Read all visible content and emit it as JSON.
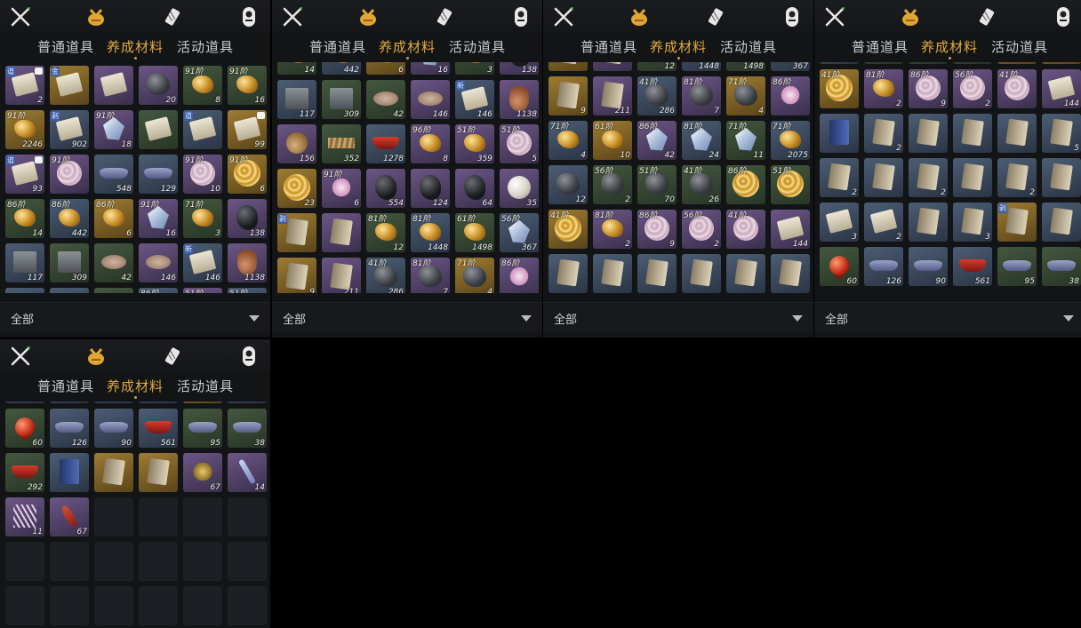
{
  "tabs": [
    "普通道具",
    "养成材料",
    "活动道具"
  ],
  "active_tab": "养成材料",
  "top_icons": [
    "crossed-swords-icon",
    "pouch-icon",
    "scroll-icon",
    "portal-icon"
  ],
  "filter": {
    "label": "全部"
  },
  "colors": {
    "tab_active": "#e1ab3d",
    "tab_inactive": "#c9cbcf",
    "panel_bg": "#121416",
    "page_bg": "#000000"
  },
  "panels": [
    {
      "rows": [
        [
          {
            "q": "p",
            "icon": "scroll",
            "tag": "道",
            "qty": "2",
            "corner": true
          },
          {
            "q": "g",
            "icon": "scroll",
            "tag": "金"
          },
          {
            "q": "p",
            "icon": "scroll"
          },
          {
            "q": "p",
            "icon": "ore",
            "qty": "20"
          },
          {
            "q": "n",
            "icon": "nugget",
            "tier": "91阶",
            "qty": "8"
          },
          {
            "q": "n",
            "icon": "nugget",
            "tier": "91阶",
            "qty": "16"
          }
        ],
        [
          {
            "q": "g",
            "icon": "nugget",
            "tier": "91阶",
            "qty": "2246"
          },
          {
            "q": "b",
            "icon": "scroll",
            "tag": "剥",
            "qty": "902"
          },
          {
            "q": "p",
            "icon": "crystal",
            "tier": "91阶",
            "qty": "18"
          },
          {
            "q": "n",
            "icon": "scroll"
          },
          {
            "q": "b",
            "icon": "scroll",
            "tag": "道"
          },
          {
            "q": "g",
            "icon": "scroll",
            "qty": "99",
            "corner": true
          }
        ],
        [
          {
            "q": "p",
            "icon": "scroll",
            "tag": "道",
            "qty": "93",
            "corner": true
          },
          {
            "q": "p",
            "icon": "shell",
            "tier": "91阶"
          },
          {
            "q": "b",
            "icon": "boat",
            "qty": "548"
          },
          {
            "q": "b",
            "icon": "boat",
            "qty": "129"
          },
          {
            "q": "p",
            "icon": "shell",
            "tier": "91阶",
            "qty": "10"
          },
          {
            "q": "g",
            "icon": "gshell",
            "tier": "91阶",
            "qty": "6"
          }
        ],
        [
          {
            "q": "n",
            "icon": "nugget",
            "tier": "86阶",
            "qty": "14"
          },
          {
            "q": "b",
            "icon": "nugget",
            "tier": "86阶",
            "qty": "442"
          },
          {
            "q": "g",
            "icon": "nugget",
            "tier": "86阶",
            "qty": "6"
          },
          {
            "q": "p",
            "icon": "crystal",
            "tier": "91阶",
            "qty": "16"
          },
          {
            "q": "n",
            "icon": "nugget",
            "tier": "71阶",
            "qty": "3"
          },
          {
            "q": "p",
            "icon": "blackore",
            "qty": "138"
          }
        ],
        [
          {
            "q": "b",
            "icon": "box",
            "qty": "117"
          },
          {
            "q": "n",
            "icon": "box",
            "qty": "309"
          },
          {
            "q": "n",
            "icon": "coin",
            "qty": "42"
          },
          {
            "q": "p",
            "icon": "coin",
            "qty": "146"
          },
          {
            "q": "b",
            "icon": "scroll",
            "tag": "新",
            "qty": "146"
          },
          {
            "q": "p",
            "icon": "jar",
            "qty": "1138"
          }
        ],
        [
          {
            "q": "b",
            "icon": "ore"
          },
          {
            "q": "b",
            "icon": "ore"
          },
          {
            "q": "n",
            "icon": "ore"
          },
          {
            "q": "b",
            "icon": "ore",
            "tier": "86阶"
          },
          {
            "q": "p",
            "icon": "ore",
            "tier": "51阶"
          },
          {
            "q": "b",
            "icon": "ore",
            "tier": "51阶"
          }
        ]
      ]
    },
    {
      "rows": [
        [
          {
            "q": "n",
            "icon": "nugget",
            "qty": "14"
          },
          {
            "q": "b",
            "icon": "nugget",
            "qty": "442"
          },
          {
            "q": "g",
            "icon": "nugget",
            "qty": "6"
          },
          {
            "q": "p",
            "icon": "crystal",
            "qty": "16"
          },
          {
            "q": "n",
            "icon": "nugget",
            "qty": "3"
          },
          {
            "q": "p",
            "icon": "blackore",
            "qty": "138"
          }
        ],
        [
          {
            "q": "b",
            "icon": "box",
            "qty": "117"
          },
          {
            "q": "n",
            "icon": "box",
            "qty": "309"
          },
          {
            "q": "n",
            "icon": "coin",
            "qty": "42"
          },
          {
            "q": "p",
            "icon": "coin",
            "qty": "146"
          },
          {
            "q": "b",
            "icon": "scroll",
            "tag": "新",
            "qty": "146"
          },
          {
            "q": "p",
            "icon": "jar",
            "qty": "1138"
          }
        ],
        [
          {
            "q": "p",
            "icon": "bag",
            "qty": "156"
          },
          {
            "q": "n",
            "icon": "sticks",
            "qty": "352"
          },
          {
            "q": "b",
            "icon": "bowl",
            "qty": "1278"
          },
          {
            "q": "p",
            "icon": "nugget",
            "tier": "96阶",
            "qty": "8"
          },
          {
            "q": "p",
            "icon": "nugget",
            "tier": "51阶",
            "qty": "359"
          },
          {
            "q": "p",
            "icon": "shell",
            "tier": "51阶",
            "qty": "5"
          }
        ],
        [
          {
            "q": "g",
            "icon": "gshell",
            "qty": "23"
          },
          {
            "q": "p",
            "icon": "flower",
            "tier": "91阶",
            "qty": "6"
          },
          {
            "q": "p",
            "icon": "blackore",
            "qty": "554"
          },
          {
            "q": "p",
            "icon": "blackore",
            "qty": "124"
          },
          {
            "q": "p",
            "icon": "blackore",
            "qty": "64"
          },
          {
            "q": "p",
            "icon": "pearl",
            "qty": "35"
          }
        ],
        [
          {
            "q": "g",
            "icon": "book",
            "tag": "剥"
          },
          {
            "q": "p",
            "icon": "book"
          },
          {
            "q": "n",
            "icon": "nugget",
            "tier": "81阶",
            "qty": "12"
          },
          {
            "q": "b",
            "icon": "nugget",
            "tier": "81阶",
            "qty": "1448"
          },
          {
            "q": "n",
            "icon": "nugget",
            "tier": "61阶",
            "qty": "1498"
          },
          {
            "q": "b",
            "icon": "crystal",
            "tier": "56阶",
            "qty": "367"
          }
        ],
        [
          {
            "q": "g",
            "icon": "book",
            "qty": "9"
          },
          {
            "q": "p",
            "icon": "book",
            "qty": "211"
          },
          {
            "q": "b",
            "icon": "ore",
            "tier": "41阶",
            "qty": "286"
          },
          {
            "q": "p",
            "icon": "ore",
            "tier": "81阶",
            "qty": "7"
          },
          {
            "q": "g",
            "icon": "ore",
            "tier": "71阶",
            "qty": "4"
          },
          {
            "q": "p",
            "icon": "flower",
            "tier": "86阶"
          }
        ]
      ]
    },
    {
      "rows": [
        [
          {
            "q": "g",
            "icon": "book"
          },
          {
            "q": "p",
            "icon": "book"
          },
          {
            "q": "n",
            "icon": "nugget",
            "tier": "81阶",
            "qty": "12"
          },
          {
            "q": "b",
            "icon": "nugget",
            "tier": "81阶",
            "qty": "1448"
          },
          {
            "q": "n",
            "icon": "nugget",
            "tier": "61阶",
            "qty": "1498"
          },
          {
            "q": "b",
            "icon": "crystal",
            "tier": "56阶",
            "qty": "367"
          }
        ],
        [
          {
            "q": "g",
            "icon": "book",
            "qty": "9"
          },
          {
            "q": "p",
            "icon": "book",
            "qty": "211"
          },
          {
            "q": "b",
            "icon": "ore",
            "tier": "41阶",
            "qty": "286"
          },
          {
            "q": "p",
            "icon": "ore",
            "tier": "81阶",
            "qty": "7"
          },
          {
            "q": "g",
            "icon": "ore",
            "tier": "71阶",
            "qty": "4"
          },
          {
            "q": "p",
            "icon": "flower",
            "tier": "86阶"
          }
        ],
        [
          {
            "q": "b",
            "icon": "nugget",
            "tier": "71阶",
            "qty": "4"
          },
          {
            "q": "g",
            "icon": "nugget",
            "tier": "61阶",
            "qty": "10"
          },
          {
            "q": "p",
            "icon": "crystal",
            "tier": "86阶",
            "qty": "42"
          },
          {
            "q": "b",
            "icon": "crystal",
            "tier": "81阶",
            "qty": "24"
          },
          {
            "q": "n",
            "icon": "crystal",
            "tier": "71阶",
            "qty": "11"
          },
          {
            "q": "b",
            "icon": "nugget",
            "tier": "71阶",
            "qty": "2075"
          }
        ],
        [
          {
            "q": "b",
            "icon": "ore",
            "qty": "12"
          },
          {
            "q": "n",
            "icon": "ore",
            "tier": "56阶",
            "qty": "2"
          },
          {
            "q": "n",
            "icon": "ore",
            "tier": "51阶",
            "qty": "70"
          },
          {
            "q": "n",
            "icon": "ore",
            "tier": "41阶",
            "qty": "26"
          },
          {
            "q": "n",
            "icon": "gshell",
            "tier": "86阶"
          },
          {
            "q": "n",
            "icon": "gshell",
            "tier": "51阶"
          }
        ],
        [
          {
            "q": "g",
            "icon": "gshell",
            "tier": "41阶"
          },
          {
            "q": "p",
            "icon": "nugget",
            "tier": "81阶",
            "qty": "2"
          },
          {
            "q": "p",
            "icon": "shell",
            "tier": "86阶",
            "qty": "9"
          },
          {
            "q": "p",
            "icon": "shell",
            "tier": "56阶",
            "qty": "2"
          },
          {
            "q": "p",
            "icon": "shell",
            "tier": "41阶"
          },
          {
            "q": "p",
            "icon": "scroll",
            "qty": "144"
          }
        ],
        [
          {
            "q": "b",
            "icon": "book"
          },
          {
            "q": "b",
            "icon": "book"
          },
          {
            "q": "b",
            "icon": "book"
          },
          {
            "q": "b",
            "icon": "book"
          },
          {
            "q": "b",
            "icon": "book"
          },
          {
            "q": "b",
            "icon": "book"
          }
        ]
      ]
    },
    {
      "rows": [
        [
          {
            "q": "b",
            "icon": "book",
            "qty": "12"
          },
          {
            "q": "n",
            "icon": "book"
          },
          {
            "q": "n",
            "icon": "book",
            "qty": "70"
          },
          {
            "q": "n",
            "icon": "book",
            "qty": "26"
          },
          {
            "q": "g",
            "icon": "book"
          },
          {
            "q": "g",
            "icon": "book"
          }
        ],
        [
          {
            "q": "g",
            "icon": "gshell",
            "tier": "41阶"
          },
          {
            "q": "p",
            "icon": "nugget",
            "tier": "81阶",
            "qty": "2"
          },
          {
            "q": "p",
            "icon": "shell",
            "tier": "86阶",
            "qty": "9"
          },
          {
            "q": "p",
            "icon": "shell",
            "tier": "56阶",
            "qty": "2"
          },
          {
            "q": "p",
            "icon": "shell",
            "tier": "41阶"
          },
          {
            "q": "p",
            "icon": "scroll",
            "qty": "144"
          }
        ],
        [
          {
            "q": "b",
            "icon": "bookblue"
          },
          {
            "q": "b",
            "icon": "book",
            "qty": "2"
          },
          {
            "q": "b",
            "icon": "book"
          },
          {
            "q": "b",
            "icon": "book"
          },
          {
            "q": "b",
            "icon": "book"
          },
          {
            "q": "b",
            "icon": "book",
            "qty": "5"
          }
        ],
        [
          {
            "q": "b",
            "icon": "book",
            "qty": "2"
          },
          {
            "q": "b",
            "icon": "book"
          },
          {
            "q": "b",
            "icon": "book",
            "qty": "2"
          },
          {
            "q": "b",
            "icon": "book"
          },
          {
            "q": "b",
            "icon": "book",
            "qty": "2"
          },
          {
            "q": "b",
            "icon": "book"
          }
        ],
        [
          {
            "q": "b",
            "icon": "scroll",
            "qty": "3"
          },
          {
            "q": "b",
            "icon": "scroll",
            "qty": "2"
          },
          {
            "q": "b",
            "icon": "book"
          },
          {
            "q": "b",
            "icon": "book",
            "qty": "3"
          },
          {
            "q": "g",
            "icon": "book",
            "tag": "剥"
          },
          {
            "q": "b",
            "icon": "book"
          }
        ],
        [
          {
            "q": "n",
            "icon": "redball",
            "qty": "60"
          },
          {
            "q": "b",
            "icon": "boat",
            "qty": "126"
          },
          {
            "q": "b",
            "icon": "boat",
            "qty": "90"
          },
          {
            "q": "b",
            "icon": "bowl",
            "qty": "561"
          },
          {
            "q": "n",
            "icon": "boat",
            "qty": "95"
          },
          {
            "q": "n",
            "icon": "boat",
            "qty": "38"
          }
        ]
      ]
    },
    {
      "rows": [
        [
          {
            "q": "b",
            "icon": "scroll",
            "qty": "3"
          },
          {
            "q": "b",
            "icon": "scroll",
            "qty": "2"
          },
          {
            "q": "b",
            "icon": "book"
          },
          {
            "q": "b",
            "icon": "book",
            "qty": "3"
          },
          {
            "q": "g",
            "icon": "book"
          },
          {
            "q": "b",
            "icon": "book"
          }
        ],
        [
          {
            "q": "n",
            "icon": "redball",
            "qty": "60"
          },
          {
            "q": "b",
            "icon": "boat",
            "qty": "126"
          },
          {
            "q": "b",
            "icon": "boat",
            "qty": "90"
          },
          {
            "q": "b",
            "icon": "bowl",
            "qty": "561"
          },
          {
            "q": "n",
            "icon": "boat",
            "qty": "95"
          },
          {
            "q": "n",
            "icon": "boat",
            "qty": "38"
          }
        ],
        [
          {
            "q": "n",
            "icon": "bowl",
            "qty": "292"
          },
          {
            "q": "b",
            "icon": "bookblue"
          },
          {
            "q": "g",
            "icon": "book"
          },
          {
            "q": "g",
            "icon": "book"
          },
          {
            "q": "p",
            "icon": "seed",
            "qty": "67"
          },
          {
            "q": "p",
            "icon": "wand",
            "qty": "14"
          }
        ],
        [
          {
            "q": "p",
            "icon": "feathers",
            "qty": "11"
          },
          {
            "q": "p",
            "icon": "pepper",
            "qty": "67"
          },
          {
            "q": "e"
          },
          {
            "q": "e"
          },
          {
            "q": "e"
          },
          {
            "q": "e"
          }
        ],
        [
          {
            "q": "e"
          },
          {
            "q": "e"
          },
          {
            "q": "e"
          },
          {
            "q": "e"
          },
          {
            "q": "e"
          },
          {
            "q": "e"
          }
        ],
        [
          {
            "q": "e"
          },
          {
            "q": "e"
          },
          {
            "q": "e"
          },
          {
            "q": "e"
          },
          {
            "q": "e"
          },
          {
            "q": "e"
          }
        ]
      ]
    }
  ]
}
